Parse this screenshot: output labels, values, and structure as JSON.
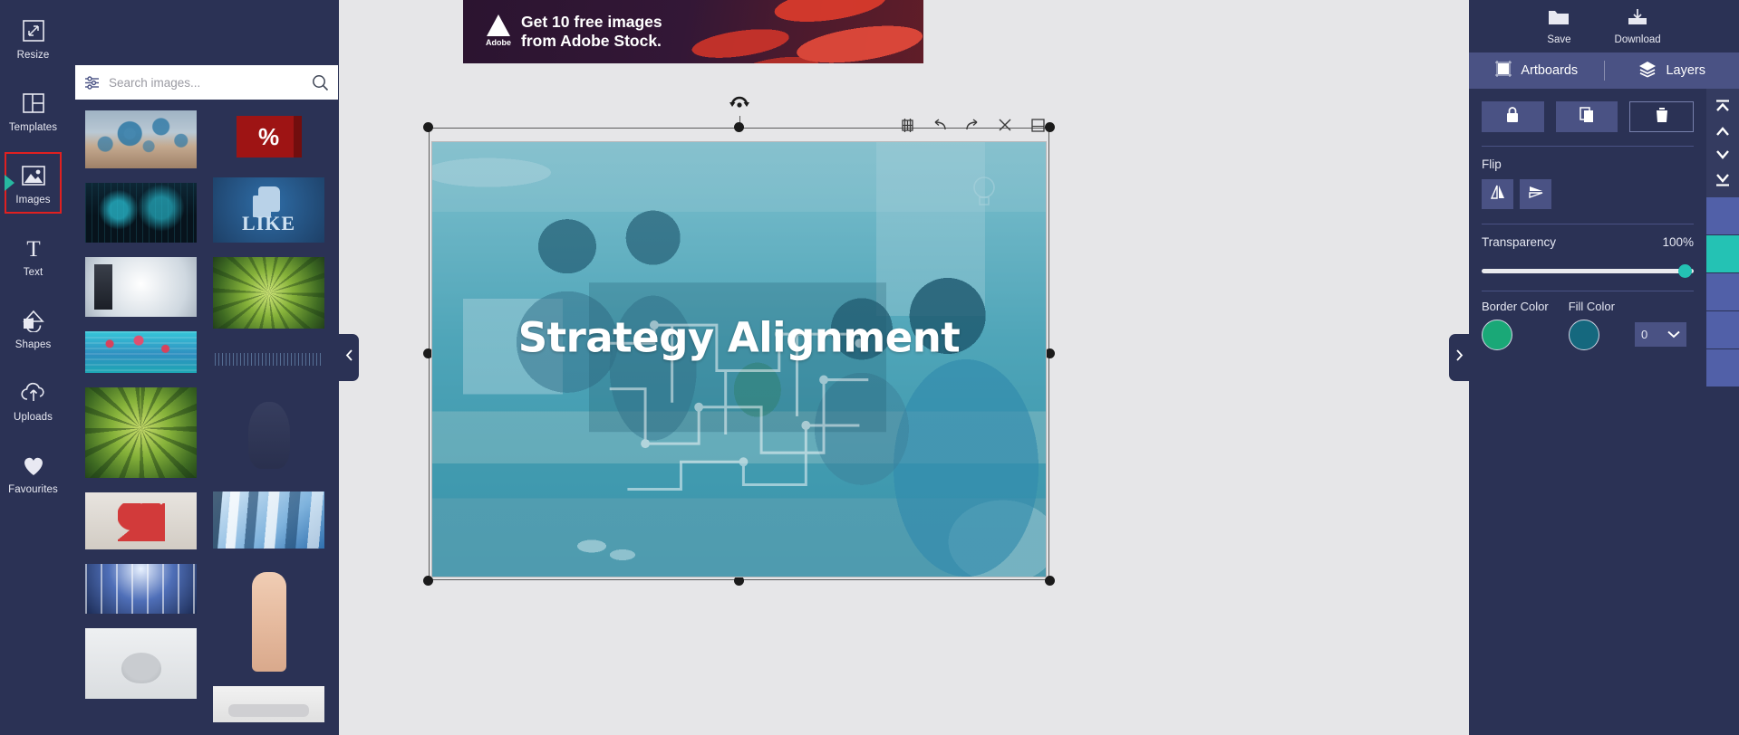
{
  "left_rail": {
    "items": [
      {
        "label": "Resize",
        "icon": "resize-icon",
        "active": false
      },
      {
        "label": "Templates",
        "icon": "templates-icon",
        "active": false
      },
      {
        "label": "Images",
        "icon": "images-icon",
        "active": true
      },
      {
        "label": "Text",
        "icon": "text-icon",
        "active": false
      },
      {
        "label": "Shapes",
        "icon": "shapes-icon",
        "active": false
      },
      {
        "label": "Uploads",
        "icon": "uploads-icon",
        "active": false
      },
      {
        "label": "Favourites",
        "icon": "heart-icon",
        "active": false
      }
    ]
  },
  "images_panel": {
    "search": {
      "placeholder": "Search images...",
      "value": ""
    },
    "filter_icon": "sliders-icon",
    "search_icon": "magnifier-icon",
    "thumbnails_left": [
      "gears-and-people",
      "holographic-display",
      "server-network-diagram",
      "hearts-underwater",
      "forest-canopy-tall",
      "broken-red-heart",
      "blue-glass-tunnel",
      "elderly-woman"
    ],
    "thumbnails_right": [
      "red-percent-cube",
      "like-thumbs-up",
      "forest-canopy-wide",
      "sound-wave",
      "dark-figure",
      "floating-monitors",
      "crossed-fingers",
      "yoga-mat"
    ]
  },
  "banner": {
    "brand": "Adobe",
    "line1": "Get 10 free images",
    "line2": "from Adobe Stock."
  },
  "canvas": {
    "collapse_left_icon": "chevron-left-icon",
    "collapse_right_icon": "chevron-right-icon",
    "rotate_icon": "rotate-icon",
    "tools": [
      {
        "name": "crop-icon",
        "label": "Crop"
      },
      {
        "name": "undo-icon",
        "label": "Undo"
      },
      {
        "name": "redo-icon",
        "label": "Redo"
      },
      {
        "name": "close-icon",
        "label": "Close"
      },
      {
        "name": "duplicate-icon",
        "label": "Duplicate"
      }
    ],
    "artwork": {
      "title": "Strategy Alignment",
      "scene": "office-team-meeting",
      "tint_color": "#1e87a0"
    }
  },
  "top_actions": [
    {
      "label": "Save",
      "icon": "folder-icon"
    },
    {
      "label": "Download",
      "icon": "download-icon"
    }
  ],
  "right_tabs": [
    {
      "label": "Artboards",
      "icon": "artboard-icon",
      "active": true
    },
    {
      "label": "Layers",
      "icon": "layers-icon",
      "active": false
    }
  ],
  "properties": {
    "buttons": [
      {
        "name": "lock-button",
        "icon": "lock-icon",
        "outlined": false
      },
      {
        "name": "duplicate-button",
        "icon": "copy-icon",
        "outlined": false
      },
      {
        "name": "delete-button",
        "icon": "trash-icon",
        "outlined": true
      }
    ],
    "flip": {
      "label": "Flip",
      "horizontal_icon": "flip-horizontal-icon",
      "vertical_icon": "flip-vertical-icon"
    },
    "transparency": {
      "label": "Transparency",
      "value": "100%",
      "percent": 100
    },
    "border_color": {
      "label": "Border Color",
      "color": "#1aa877"
    },
    "fill_color": {
      "label": "Fill Color",
      "color": "#15687e"
    },
    "border_width": {
      "value": "0",
      "chevron_icon": "chevron-down-icon"
    }
  },
  "layer_strip": {
    "order_buttons": [
      {
        "name": "bring-to-front-button",
        "icon": "to-top-icon"
      },
      {
        "name": "bring-forward-button",
        "icon": "up-icon"
      },
      {
        "name": "send-backward-button",
        "icon": "down-icon"
      },
      {
        "name": "send-to-back-button",
        "icon": "to-bottom-icon"
      }
    ],
    "layers": [
      {
        "name": "layer-1",
        "color": "#5160a8"
      },
      {
        "name": "layer-2",
        "color": "#24c2b4"
      },
      {
        "name": "layer-3",
        "color": "#5160a8"
      },
      {
        "name": "layer-4",
        "color": "#5160a8"
      },
      {
        "name": "layer-5",
        "color": "#5160a8"
      }
    ]
  },
  "theme": {
    "rail_bg": "#2b3255",
    "tab_bg": "#4a5284",
    "stage_bg": "#e6e6e8",
    "accent_teal": "#24c2b4",
    "active_outline": "#e02020"
  }
}
